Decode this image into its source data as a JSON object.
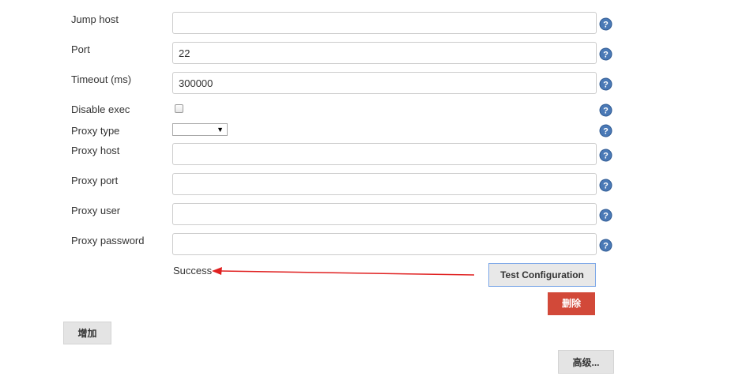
{
  "form": {
    "fields": [
      {
        "label": "Jump host",
        "value": ""
      },
      {
        "label": "Port",
        "value": "22"
      },
      {
        "label": "Timeout (ms)",
        "value": "300000"
      },
      {
        "label": "Disable exec",
        "checked": false
      },
      {
        "label": "Proxy type",
        "selected": ""
      },
      {
        "label": "Proxy host",
        "value": ""
      },
      {
        "label": "Proxy port",
        "value": ""
      },
      {
        "label": "Proxy user",
        "value": ""
      },
      {
        "label": "Proxy password",
        "value": ""
      }
    ]
  },
  "status": {
    "text": "Success"
  },
  "buttons": {
    "test_configuration": "Test Configuration",
    "delete": "删除",
    "add": "增加",
    "advanced": "高级..."
  },
  "icons": {
    "help": "help-icon",
    "arrow": "red-arrow-annotation"
  },
  "colors": {
    "help_icon": "#4a79b6",
    "delete_button": "#d24939",
    "arrow": "#e02020"
  }
}
